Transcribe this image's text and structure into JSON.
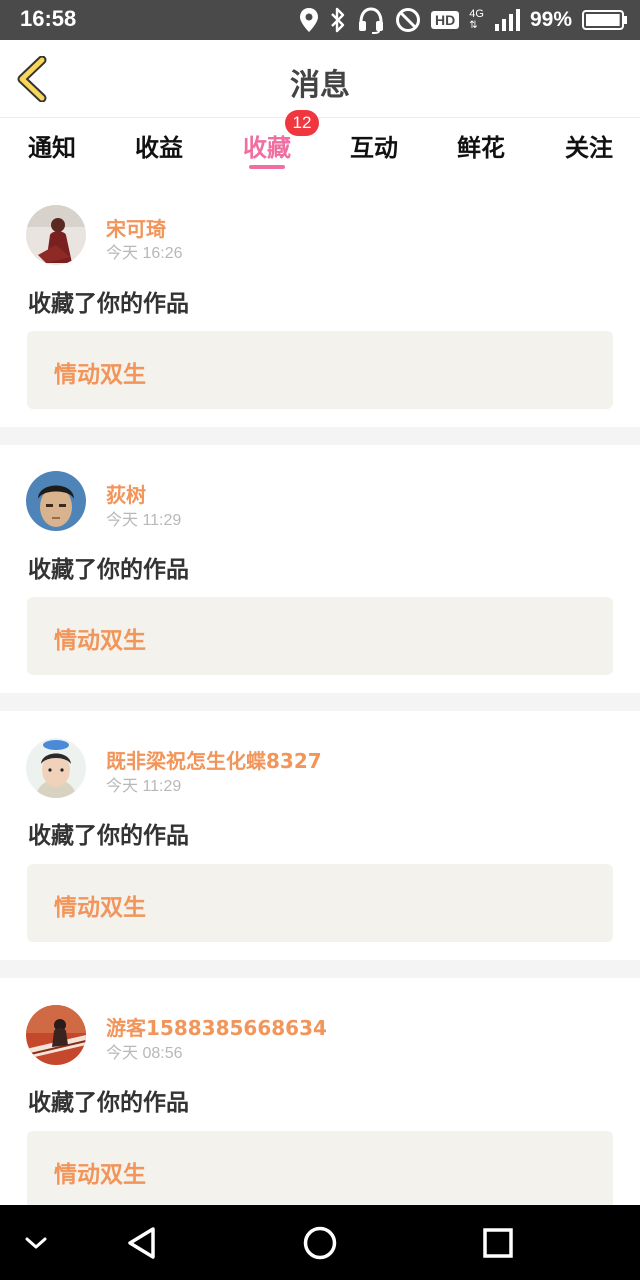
{
  "status_bar": {
    "time": "16:58",
    "hd_label": "HD",
    "network_label": "4G",
    "battery_percent": "99%",
    "battery_level": 0.99,
    "icons": [
      "location-icon",
      "bluetooth-icon",
      "headset-icon",
      "do-not-disturb-icon",
      "hd-icon",
      "signal-icon",
      "battery-icon"
    ]
  },
  "header": {
    "title": "消息",
    "back_icon": "chevron-left-icon",
    "accent_color": "#f7d65a"
  },
  "tabs": {
    "items": [
      {
        "label": "通知",
        "active": false
      },
      {
        "label": "收益",
        "active": false
      },
      {
        "label": "收藏",
        "active": true
      },
      {
        "label": "互动",
        "active": false
      },
      {
        "label": "鲜花",
        "active": false
      },
      {
        "label": "关注",
        "active": false
      }
    ],
    "badge_count": "12",
    "active_color": "#f06fa0"
  },
  "feed": {
    "items": [
      {
        "user": "宋可琦",
        "time": "今天 16:26",
        "action": "收藏了你的作品",
        "work_title": "情动双生"
      },
      {
        "user": "荻树",
        "time": "今天 11:29",
        "action": "收藏了你的作品",
        "work_title": "情动双生"
      },
      {
        "user": "既非梁祝怎生化蝶8327",
        "time": "今天 11:29",
        "action": "收藏了你的作品",
        "work_title": "情动双生"
      },
      {
        "user": "游客1588385668634",
        "time": "今天 08:56",
        "action": "收藏了你的作品",
        "work_title": "情动双生"
      }
    ],
    "name_color": "#f2955a"
  },
  "nav_bar": {
    "icons": [
      "collapse-icon",
      "back-triangle-icon",
      "home-circle-icon",
      "recents-square-icon"
    ]
  }
}
